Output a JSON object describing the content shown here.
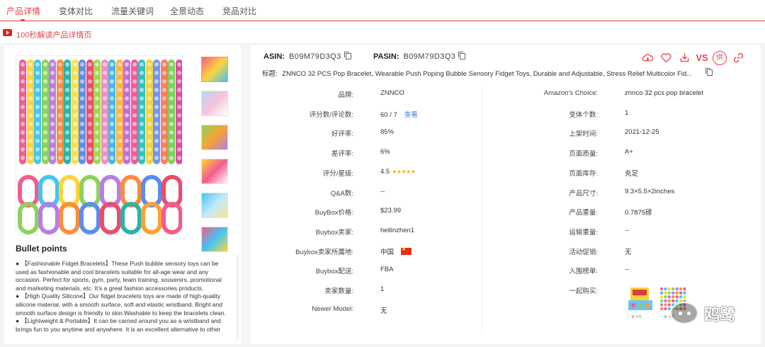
{
  "tabs": [
    {
      "label": "产品详情",
      "active": true
    },
    {
      "label": "变体对比",
      "active": false
    },
    {
      "label": "流量关键词",
      "active": false
    },
    {
      "label": "全景动态",
      "active": false
    },
    {
      "label": "竞品对比",
      "active": false
    }
  ],
  "video_link": "100秒解读产品详情页",
  "left": {
    "bullet_title": "Bullet points",
    "bullets": [
      "【Fashionable Fidget Bracelets】These Push bubble sensory toys can be used as fashionable and cool bracelets suitable for all-age wear and any occasion. Perfect for sports, gym, party, team training, souvenirs, promotional and marketing materials, etc. It’s a great fashion accessories products.",
      "【High Quality Silicone】Our fidget bracelets toys are made of high-quality silicone material, with a smooth surface, soft and elastic wristband. Bright and smooth surface design is friendly to skin.Washable to keep the bracelets clean.",
      "【Lightweight & Portable】It can be carried around you as a wristband and brings fun to you anytime and anywhere. It is an excellent alternative to other"
    ],
    "bullet_mark": "●"
  },
  "product": {
    "asin_label": "ASIN:",
    "asin": "B09M79D3Q3",
    "pasin_label": "PASIN:",
    "pasin": "B09M79D3Q3",
    "title_label": "标题:",
    "title": "ZNNCO 32 PCS Pop Bracelet, Wearable Push Poping Bubble Sensory Fidget Toys, Durable and Adjustable, Stress Relief Multicolor Fid..."
  },
  "actions": {
    "vs": "VS",
    "supplier": "供"
  },
  "left_fields": [
    {
      "label": "品牌:",
      "value": "ZNNCO"
    },
    {
      "label": "评分数/评论数:",
      "value": "60 / 7",
      "link": "查看"
    },
    {
      "label": "好评率:",
      "value": "85%"
    },
    {
      "label": "差评率:",
      "value": "6%"
    },
    {
      "label": "评分/星级:",
      "value": "4.5",
      "stars": "★★★★★"
    },
    {
      "label": "Q&A数:",
      "value": "--"
    },
    {
      "label": "BuyBox价格:",
      "value": "$23.99"
    },
    {
      "label": "Buybox卖家:",
      "value": "heilinzhen1"
    },
    {
      "label": "Buybox卖家所属地:",
      "value": "中国"
    },
    {
      "label": "Buybox配送:",
      "value": "FBA"
    },
    {
      "label": "卖家数量:",
      "value": "1"
    },
    {
      "label": "Newer Model:",
      "value": "无"
    }
  ],
  "right_fields": [
    {
      "label": "Amazon's Choice:",
      "value": "znnco 32 pcs pop bracelet"
    },
    {
      "label": "变体个数:",
      "value": "1"
    },
    {
      "label": "上架时间:",
      "value": "2021-12-25"
    },
    {
      "label": "页面质量:",
      "value": "A+"
    },
    {
      "label": "页面库存:",
      "value": "充足"
    },
    {
      "label": "产品尺寸:",
      "value": "9.3×5.5×2inches"
    },
    {
      "label": "产品重量:",
      "value": "0.7875磅"
    },
    {
      "label": "运输重量:",
      "value": "--"
    },
    {
      "label": "活动促销:",
      "value": "无"
    },
    {
      "label": "入围榜单:",
      "value": "--"
    },
    {
      "label": "一起购买:",
      "value": ""
    }
  ],
  "buy_together_icons": "♡ ⊕ VS",
  "watermark": "鸥鹭",
  "colors": {
    "accent": "#e8454a",
    "link": "#3b7ddd",
    "star": "#f5b301"
  }
}
